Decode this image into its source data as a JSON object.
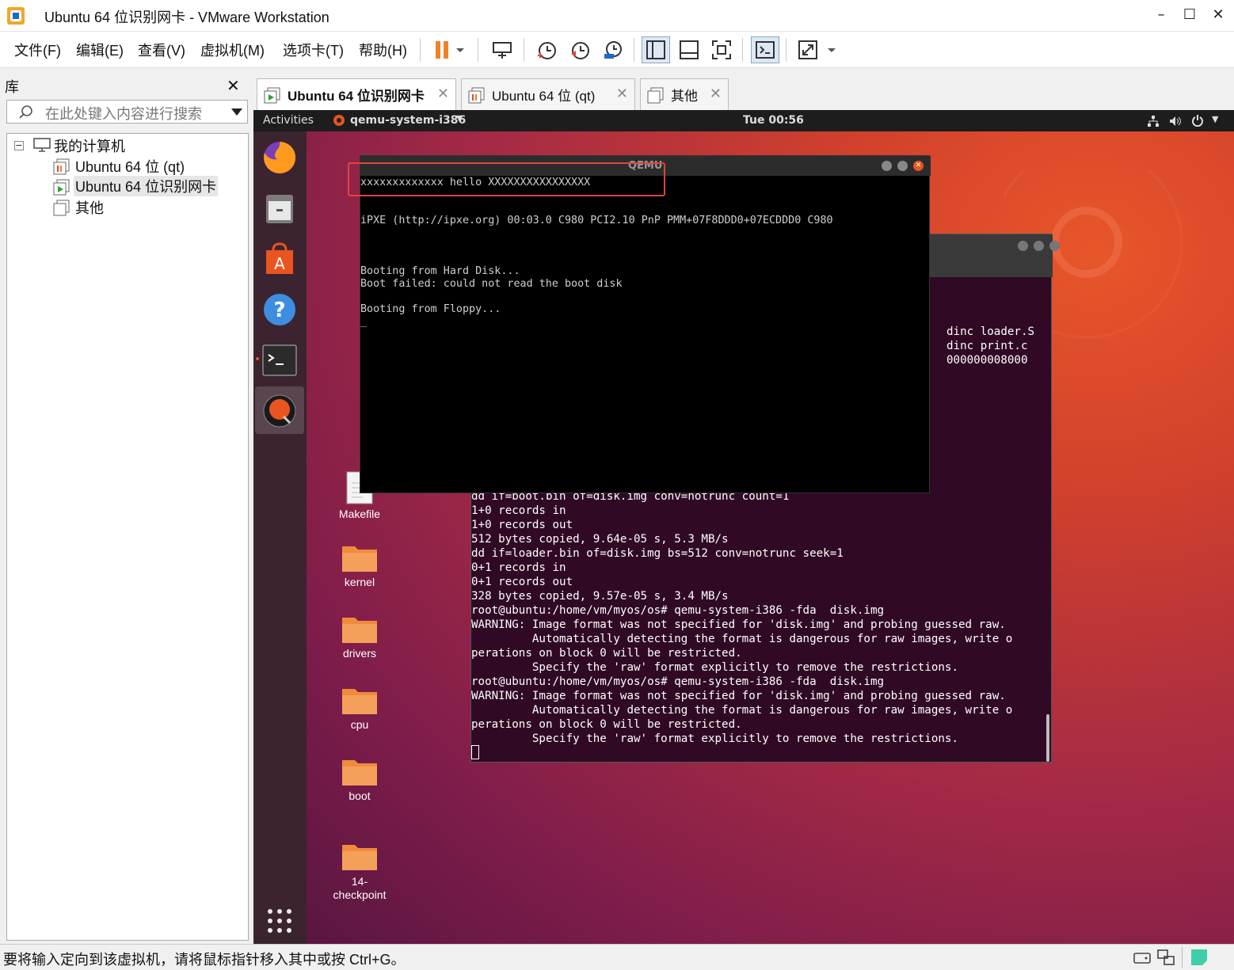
{
  "window": {
    "title": "Ubuntu 64 位识别网卡 - VMware Workstation",
    "minimize": "–",
    "maximize": "☐",
    "close": "✕"
  },
  "menu": [
    "文件(F)",
    "编辑(E)",
    "查看(V)",
    "虚拟机(M)",
    "选项卡(T)",
    "帮助(H)"
  ],
  "library": {
    "title": "库",
    "close": "✕",
    "search_placeholder": "在此处键入内容进行搜索",
    "tree": {
      "root": "我的计算机",
      "items": [
        "Ubuntu 64 位 (qt)",
        "Ubuntu 64 位识别网卡",
        "其他"
      ],
      "selected_index": 1
    }
  },
  "tabs": [
    {
      "label": "Ubuntu 64 位识别网卡",
      "active": true
    },
    {
      "label": "Ubuntu 64 位 (qt)",
      "active": false
    },
    {
      "label": "其他",
      "active": false
    }
  ],
  "ubuntu": {
    "activities": "Activities",
    "app_menu": "qemu-system-i386",
    "clock": "Tue 00:56",
    "desktop_icons": [
      "Makefile",
      "kernel",
      "drivers",
      "cpu",
      "boot",
      "14-\ncheckpoint"
    ]
  },
  "qemu": {
    "title": "QEMU",
    "lines": [
      "xxxxxxxxxxxxx hello XXXXXXXXXXXXXXXX",
      "",
      "",
      "iPXE (http://ipxe.org) 00:03.0 C980 PCI2.10 PnP PMM+07F8DDD0+07ECDDD0 C980",
      "",
      "",
      "",
      "Booting from Hard Disk...",
      "Boot failed: could not read the boot disk",
      "",
      "Booting from Floppy...",
      "_"
    ]
  },
  "terminal": {
    "partial_lines": [
      "dinc loader.S",
      "dinc print.c",
      "",
      "000000008000"
    ],
    "lines": [
      "dd if=boot.bin of=disk.img conv=notrunc count=1",
      "1+0 records in",
      "1+0 records out",
      "512 bytes copied, 9.64e-05 s, 5.3 MB/s",
      "dd if=loader.bin of=disk.img bs=512 conv=notrunc seek=1",
      "0+1 records in",
      "0+1 records out",
      "328 bytes copied, 9.57e-05 s, 3.4 MB/s",
      "root@ubuntu:/home/vm/myos/os# qemu-system-i386 -fda  disk.img",
      "WARNING: Image format was not specified for 'disk.img' and probing guessed raw.",
      "         Automatically detecting the format is dangerous for raw images, write o",
      "perations on block 0 will be restricted.",
      "         Specify the 'raw' format explicitly to remove the restrictions.",
      "root@ubuntu:/home/vm/myos/os# qemu-system-i386 -fda  disk.img",
      "WARNING: Image format was not specified for 'disk.img' and probing guessed raw.",
      "         Automatically detecting the format is dangerous for raw images, write o",
      "perations on block 0 will be restricted.",
      "         Specify the 'raw' format explicitly to remove the restrictions."
    ]
  },
  "status": {
    "text": "要将输入定向到该虚拟机，请将鼠标指针移入其中或按 Ctrl+G。"
  },
  "colors": {
    "accent": "#e0453a",
    "ubuntu_orange": "#e95420",
    "terminal_bg": "#300a24"
  }
}
